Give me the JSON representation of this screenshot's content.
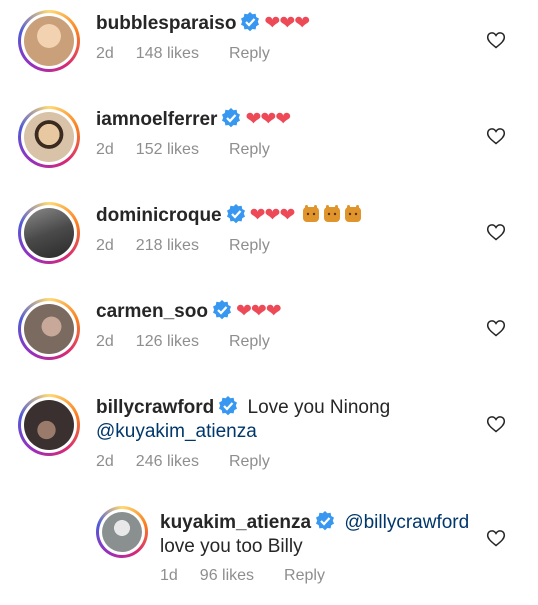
{
  "colors": {
    "heart": "#ed4956",
    "verified": "#3897f0",
    "meta": "#8e8e8e",
    "mention": "#00376b"
  },
  "comments": [
    {
      "username": "bubblesparaiso",
      "text": "❤❤❤",
      "age": "2d",
      "likes": "148 likes",
      "reply": "Reply",
      "avatar_color": "#c9a07a"
    },
    {
      "username": "iamnoelferrer",
      "text": "❤❤❤",
      "age": "2d",
      "likes": "152 likes",
      "reply": "Reply",
      "avatar_color": "#d8c2a8"
    },
    {
      "username": "dominicroque",
      "text": "❤❤❤",
      "age": "2d",
      "likes": "218 likes",
      "reply": "Reply",
      "avatar_color": "#5a5a5a",
      "extra_icons": [
        "raised-hands-icon",
        "raised-hands-icon",
        "raised-hands-icon"
      ]
    },
    {
      "username": "carmen_soo",
      "text": "❤❤❤",
      "age": "2d",
      "likes": "126 likes",
      "reply": "Reply",
      "avatar_color": "#7a6a60"
    },
    {
      "username": "billycrawford",
      "text": "Love you Ninong",
      "mention": "@kuyakim_atienza",
      "age": "2d",
      "likes": "246 likes",
      "reply": "Reply",
      "avatar_color": "#3a3030"
    }
  ],
  "reply_comment": {
    "username": "kuyakim_atienza",
    "mention": "@billycrawford",
    "text": "love you too Billy",
    "age": "1d",
    "likes": "96 likes",
    "reply": "Reply",
    "avatar_color": "#8a9090"
  }
}
